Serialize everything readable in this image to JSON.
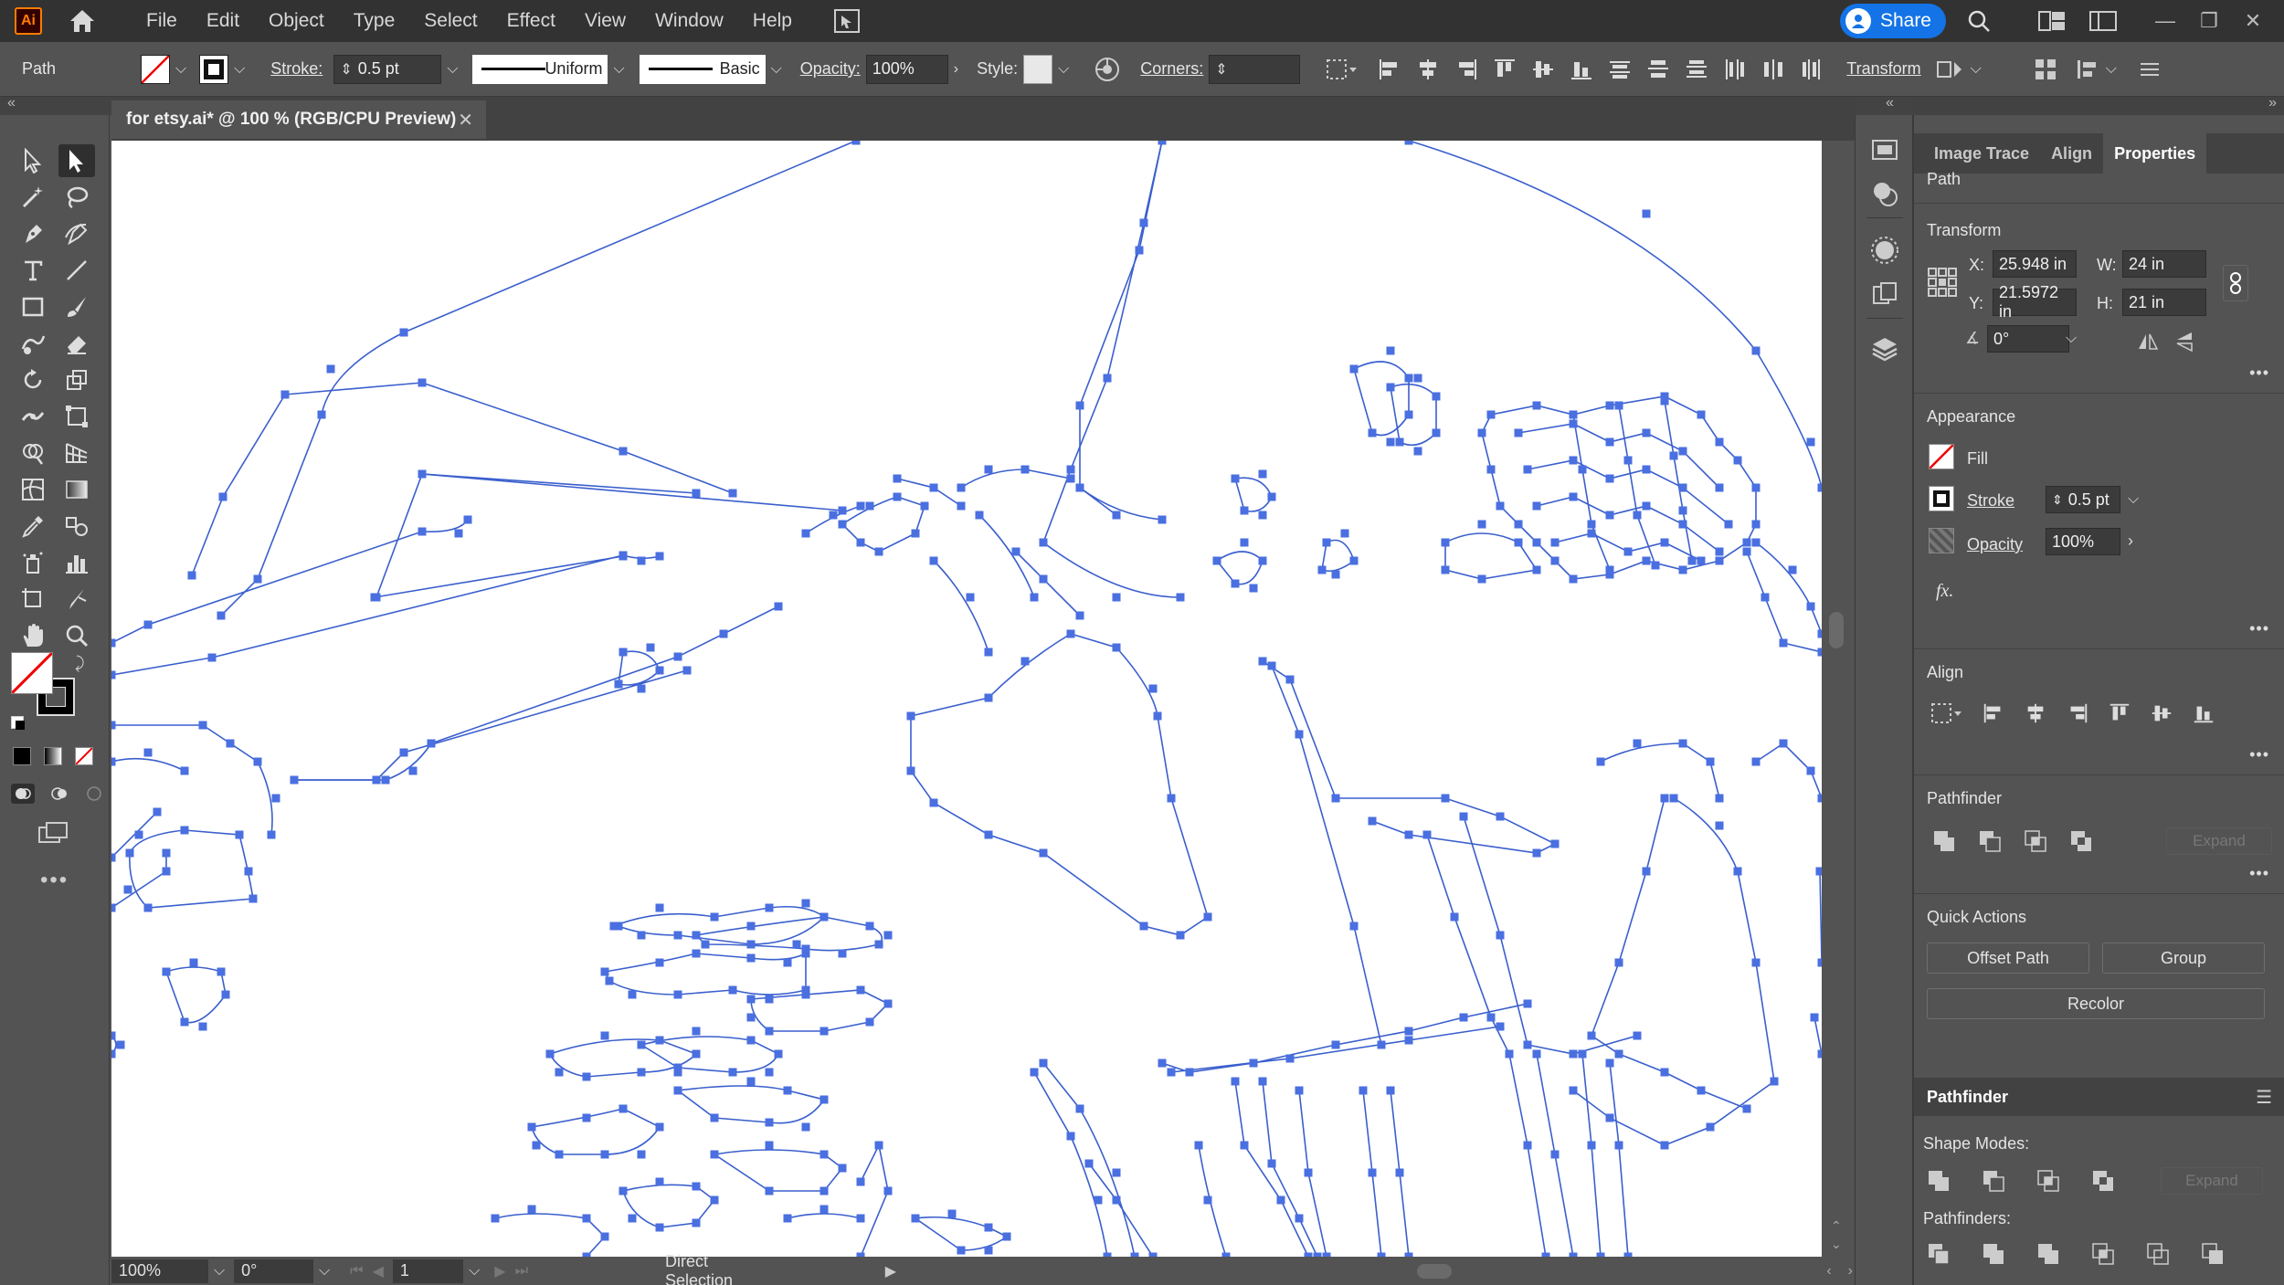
{
  "app": {
    "logo_text": "Ai",
    "menu": [
      "File",
      "Edit",
      "Object",
      "Type",
      "Select",
      "Effect",
      "View",
      "Window",
      "Help"
    ],
    "share_label": "Share",
    "window_controls": [
      "—",
      "❐",
      "✕"
    ]
  },
  "control_bar": {
    "selection_type": "Path",
    "stroke_label": "Stroke:",
    "stroke_weight": "0.5 pt",
    "stroke_profile": "Uniform",
    "brush": "Basic",
    "opacity_label": "Opacity:",
    "opacity_value": "100%",
    "style_label": "Style:",
    "corners_label": "Corners:",
    "corners_value": "",
    "transform_label": "Transform"
  },
  "document": {
    "tab_title": "for etsy.ai* @ 100 % (RGB/CPU Preview)",
    "tab_close": "✕"
  },
  "status_bar": {
    "zoom": "100%",
    "rotation": "0°",
    "artboard": "1",
    "tool_name": "Direct Selection"
  },
  "panel": {
    "tabs": [
      "Image Trace",
      "Align",
      "Properties"
    ],
    "active_tab": "Properties",
    "selection_kind": "Path",
    "transform": {
      "title": "Transform",
      "x_label": "X:",
      "x_value": "25.948 in",
      "y_label": "Y:",
      "y_value": "21.5972 in",
      "w_label": "W:",
      "w_value": "24 in",
      "h_label": "H:",
      "h_value": "21 in",
      "angle_value": "0°"
    },
    "appearance": {
      "title": "Appearance",
      "fill_label": "Fill",
      "stroke_label": "Stroke",
      "stroke_value": "0.5 pt",
      "opacity_label": "Opacity",
      "opacity_value": "100%",
      "fx_label": "fx."
    },
    "align": {
      "title": "Align"
    },
    "pathfinder": {
      "title": "Pathfinder",
      "expand_label": "Expand"
    },
    "quick_actions": {
      "title": "Quick Actions",
      "offset_path": "Offset Path",
      "group": "Group",
      "recolor": "Recolor"
    },
    "pathfinder_panel": {
      "title": "Pathfinder",
      "shape_modes_label": "Shape Modes:",
      "expand_label": "Expand",
      "pathfinders_label": "Pathfinders:"
    }
  },
  "colors": {
    "path_stroke": "#3a5fcd",
    "anchor": "#4a6fe0",
    "share_blue": "#1473e6",
    "ui_dark": "#323232",
    "ui_mid": "#535353"
  }
}
